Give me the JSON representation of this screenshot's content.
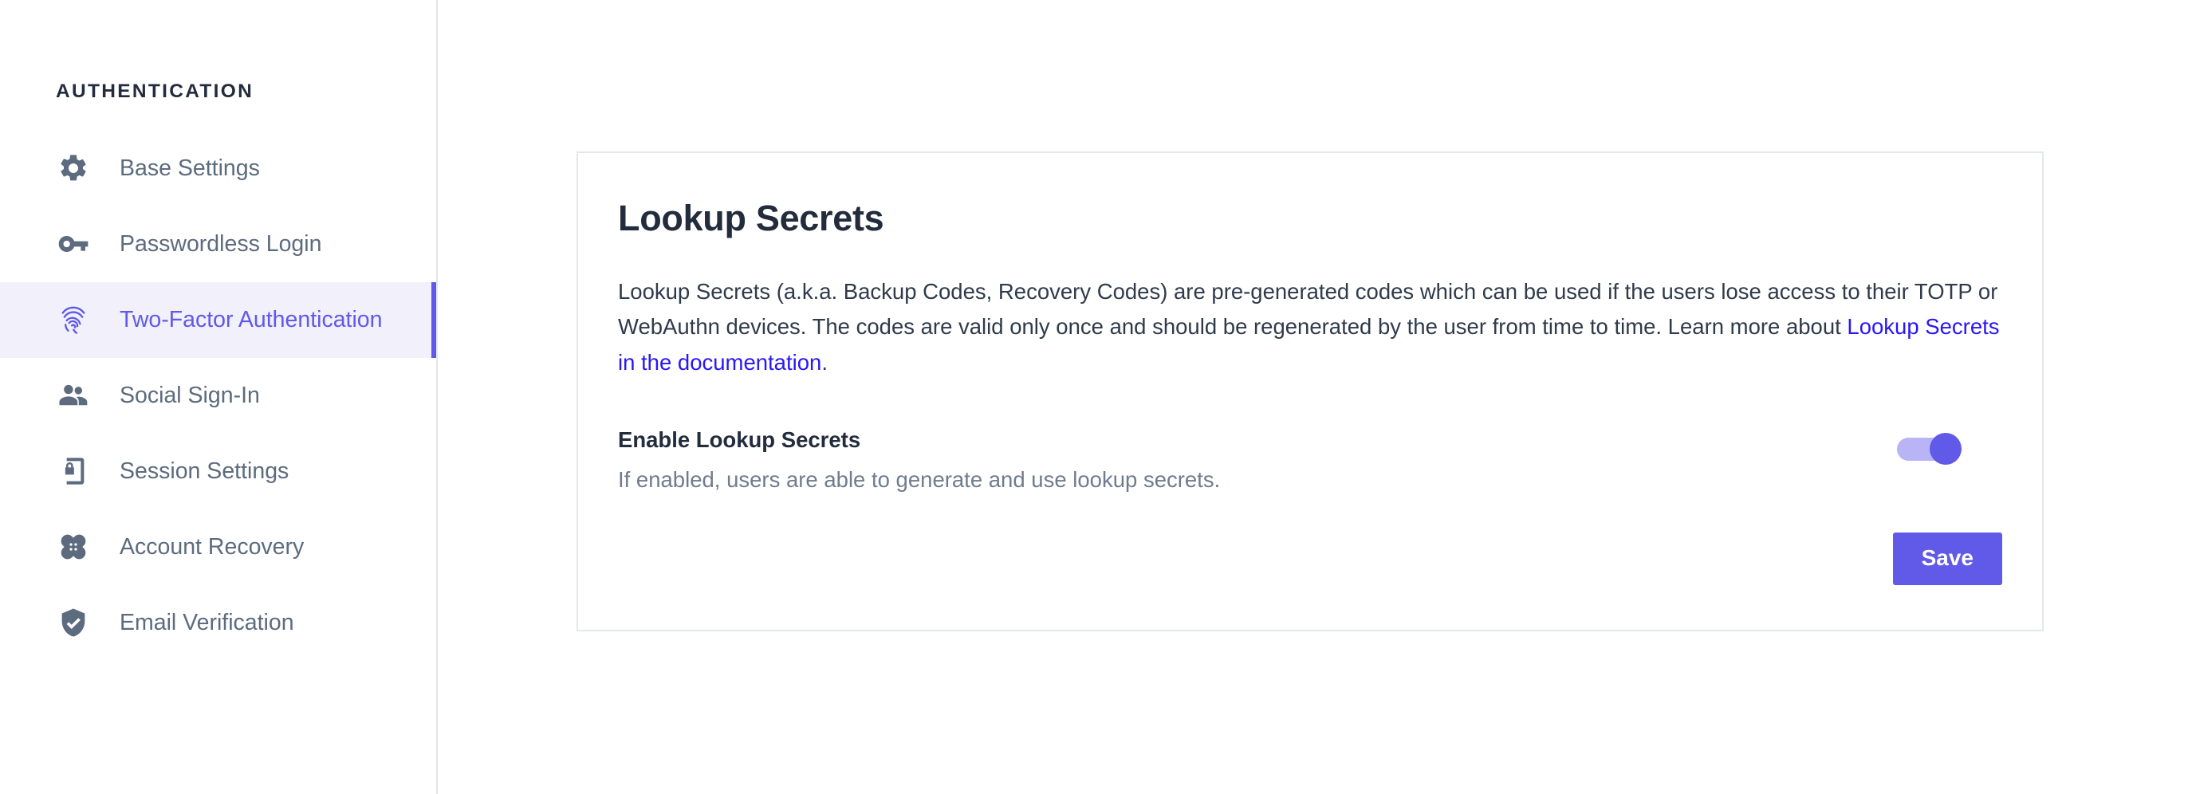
{
  "sidebar": {
    "title": "AUTHENTICATION",
    "items": [
      {
        "label": "Base Settings",
        "icon": "gear-icon",
        "active": false
      },
      {
        "label": "Passwordless Login",
        "icon": "key-icon",
        "active": false
      },
      {
        "label": "Two-Factor Authentication",
        "icon": "fingerprint-icon",
        "active": true
      },
      {
        "label": "Social Sign-In",
        "icon": "people-icon",
        "active": false
      },
      {
        "label": "Session Settings",
        "icon": "phone-lock-icon",
        "active": false
      },
      {
        "label": "Account Recovery",
        "icon": "bandage-icon",
        "active": false
      },
      {
        "label": "Email Verification",
        "icon": "shield-check-icon",
        "active": false
      }
    ]
  },
  "card": {
    "title": "Lookup Secrets",
    "description_before_link": "Lookup Secrets (a.k.a. Backup Codes, Recovery Codes) are pre-generated codes which can be used if the users lose access to their TOTP or WebAuthn devices. The codes are valid only once and should be regenerated by the user from time to time. Learn more about ",
    "description_link": "Lookup Secrets in the documentation",
    "description_after_link": ".",
    "setting": {
      "label": "Enable Lookup Secrets",
      "help": "If enabled, users are able to generate and use lookup secrets.",
      "toggle_state": "on"
    },
    "save_label": "Save"
  },
  "colors": {
    "accent": "#6159e8",
    "accent_soft": "#b8b4f5",
    "active_row_bg": "#f1f0fb",
    "link": "#2916f5",
    "heading": "#232c3d",
    "muted_text": "#6f7c8d",
    "icon": "#5c6b7e",
    "card_border": "#e4e7ec",
    "sidebar_border": "#e2e6ea"
  }
}
